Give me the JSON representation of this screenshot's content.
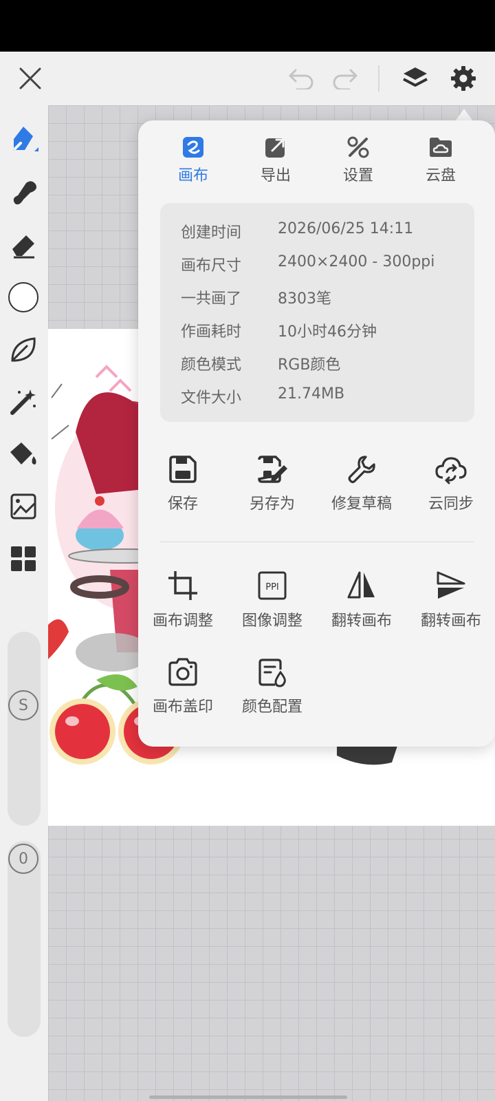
{
  "top_bar": {
    "close_icon": "close-icon",
    "undo_icon": "undo-icon",
    "redo_icon": "redo-icon",
    "layers_icon": "layers-icon",
    "settings_icon": "gear-icon"
  },
  "toolbar": {
    "tools": [
      "brush-icon",
      "smudge-icon",
      "eraser-icon",
      "color-icon",
      "leaf-icon",
      "magic-wand-icon",
      "fill-bucket-icon",
      "image-icon",
      "grid-icon"
    ],
    "size_badge": "S",
    "opacity_badge": "0"
  },
  "popover": {
    "tabs": [
      {
        "label": "画布",
        "icon": "canvas-icon",
        "active": true
      },
      {
        "label": "导出",
        "icon": "export-icon",
        "active": false
      },
      {
        "label": "设置",
        "icon": "tools-icon",
        "active": false
      },
      {
        "label": "云盘",
        "icon": "cloud-folder-icon",
        "active": false
      }
    ],
    "info": [
      {
        "key": "创建时间",
        "value": "2026/06/25 14:11"
      },
      {
        "key": "画布尺寸",
        "value": "2400×2400 - 300ppi"
      },
      {
        "key": "一共画了",
        "value": "8303笔"
      },
      {
        "key": "作画耗时",
        "value": "10小时46分钟"
      },
      {
        "key": "颜色模式",
        "value": "RGB颜色"
      },
      {
        "key": "文件大小",
        "value": "21.74MB"
      }
    ],
    "actions_row1": [
      {
        "label": "保存",
        "icon": "save-icon"
      },
      {
        "label": "另存为",
        "icon": "save-as-icon"
      },
      {
        "label": "修复草稿",
        "icon": "wrench-icon"
      },
      {
        "label": "云同步",
        "icon": "cloud-sync-icon"
      }
    ],
    "actions_row2": [
      {
        "label": "画布调整",
        "icon": "crop-icon"
      },
      {
        "label": "图像调整",
        "icon": "ppi-icon",
        "icon_text": "PPI"
      },
      {
        "label": "翻转画布",
        "icon": "flip-horizontal-icon"
      },
      {
        "label": "翻转画布",
        "icon": "flip-vertical-icon"
      }
    ],
    "actions_row3": [
      {
        "label": "画布盖印",
        "icon": "camera-icon"
      },
      {
        "label": "颜色配置",
        "icon": "color-profile-icon"
      }
    ]
  },
  "colors": {
    "accent": "#2f7ae5",
    "icon": "#333333",
    "panel": "#f4f4f4"
  }
}
